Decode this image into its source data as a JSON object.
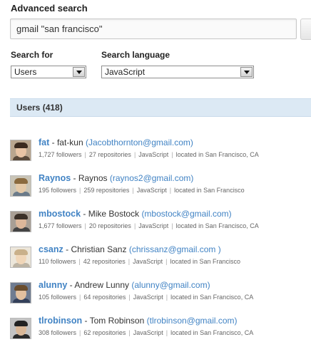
{
  "page": {
    "title": "Advanced search"
  },
  "search": {
    "query": "gmail \"san francisco\""
  },
  "filters": {
    "search_for_label": "Search for",
    "search_for_value": "Users",
    "language_label": "Search language",
    "language_value": "JavaScript"
  },
  "results": {
    "header": "Users (418)",
    "users": [
      {
        "login": "fat",
        "name": "fat-kun",
        "email": "(Jacobthornton@gmail.com)",
        "followers": "1,727 followers",
        "repos": "27 repositories",
        "language": "JavaScript",
        "location": "located in San Francisco, CA"
      },
      {
        "login": "Raynos",
        "name": "Raynos",
        "email": "(raynos2@gmail.com)",
        "followers": "195 followers",
        "repos": "259 repositories",
        "language": "JavaScript",
        "location": "located in San Francisco"
      },
      {
        "login": "mbostock",
        "name": "Mike Bostock",
        "email": "(mbostock@gmail.com)",
        "followers": "1,677 followers",
        "repos": "20 repositories",
        "language": "JavaScript",
        "location": "located in San Francisco, CA"
      },
      {
        "login": "csanz",
        "name": "Christian Sanz",
        "email": "(chrissanz@gmail.com )",
        "followers": "110 followers",
        "repos": "42 repositories",
        "language": "JavaScript",
        "location": "located in San Francisco"
      },
      {
        "login": "alunny",
        "name": "Andrew Lunny",
        "email": "(alunny@gmail.com)",
        "followers": "105 followers",
        "repos": "64 repositories",
        "language": "JavaScript",
        "location": "located in San Francisco, CA"
      },
      {
        "login": "tlrobinson",
        "name": "Tom Robinson",
        "email": "(tlrobinson@gmail.com)",
        "followers": "308 followers",
        "repos": "62 repositories",
        "language": "JavaScript",
        "location": "located in San Francisco, CA"
      }
    ]
  }
}
